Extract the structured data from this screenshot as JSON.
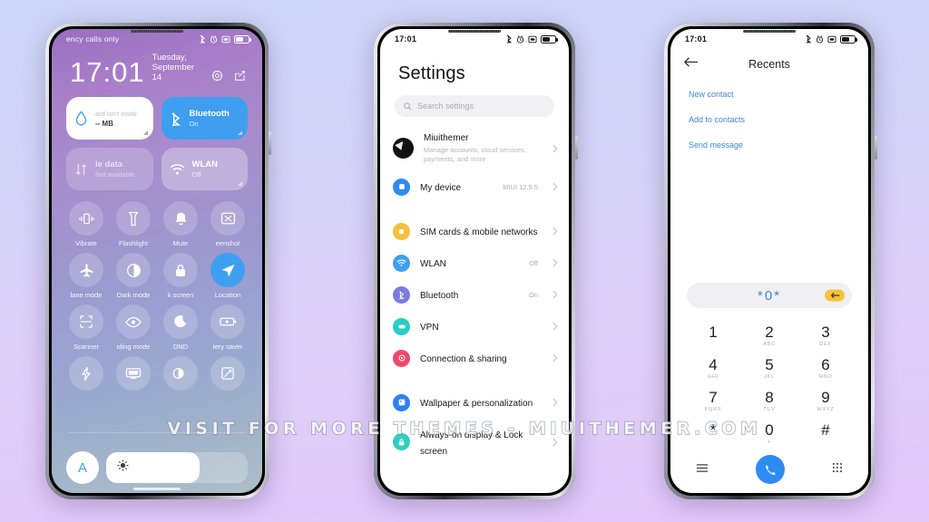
{
  "background": {
    "top_color": "#cdd6f7",
    "bottom_color": "#e3c8f8"
  },
  "watermark": {
    "text": "VISIT FOR MORE THEMES - MIUITHEMER.COM"
  },
  "accent": {
    "blue": "#3e9ff0",
    "link_blue": "#3d86d8",
    "call_green_blue": "#2d8cf5",
    "yellow": "#f5c43c"
  },
  "phone1": {
    "statusbar": {
      "carrier": "ency calls only",
      "icons": [
        "bluetooth-icon",
        "alarm-icon",
        "sim-icon",
        "battery-icon"
      ]
    },
    "clock": {
      "time": "17:01",
      "date": "Tuesday, September 14"
    },
    "header_actions": [
      "settings-gear-icon",
      "edit-icon"
    ],
    "big_tiles": [
      {
        "name": "data-usage",
        "icon": "water-drop-icon",
        "warning": "ard isn't instal",
        "usage": "-- MB",
        "state": "white"
      },
      {
        "name": "bluetooth",
        "icon": "bluetooth-icon",
        "title": "Bluetooth",
        "sub": "On",
        "state": "blue"
      },
      {
        "name": "mobile-data",
        "icon": "data-arrows-icon",
        "title": "le data",
        "sub": "Not available",
        "state": "dim"
      },
      {
        "name": "wlan",
        "icon": "wifi-icon",
        "title": "WLAN",
        "sub": "Off",
        "state": "translucent"
      }
    ],
    "toggles": [
      {
        "label": "Vibrate",
        "icon": "vibrate-icon",
        "on": false
      },
      {
        "label": "Flashlight",
        "icon": "flashlight-icon",
        "on": false
      },
      {
        "label": "Mute",
        "icon": "bell-icon",
        "on": false
      },
      {
        "label": "eenshot",
        "icon": "screenshot-icon",
        "on": false
      },
      {
        "label": "lane mode",
        "icon": "airplane-icon",
        "on": false
      },
      {
        "label": "Dark mode",
        "icon": "contrast-icon",
        "on": false
      },
      {
        "label": "k screen",
        "icon": "lock-icon",
        "on": false
      },
      {
        "label": "Location",
        "icon": "location-arrow-icon",
        "on": true
      },
      {
        "label": "Scanner",
        "icon": "scan-frame-icon",
        "on": false
      },
      {
        "label": "iding mode",
        "icon": "eye-icon",
        "on": false
      },
      {
        "label": "DND",
        "icon": "moon-icon",
        "on": false
      },
      {
        "label": "tery saver",
        "icon": "battery-plus-icon",
        "on": false
      },
      {
        "label": "",
        "icon": "lightning-icon",
        "on": false
      },
      {
        "label": "",
        "icon": "cast-icon",
        "on": false
      },
      {
        "label": "",
        "icon": "half-circle-icon",
        "on": false
      },
      {
        "label": "",
        "icon": "rotate-icon",
        "on": false
      }
    ],
    "brightness": {
      "auto_label": "A",
      "icon": "sun-icon",
      "level_percent": 66
    }
  },
  "phone2": {
    "statusbar": {
      "time": "17:01",
      "icons": [
        "bluetooth-icon",
        "alarm-icon",
        "sim-icon",
        "battery-icon"
      ]
    },
    "title": "Settings",
    "search": {
      "placeholder": "Search settings",
      "icon": "search-icon"
    },
    "groups": [
      {
        "rows": [
          {
            "label": "Miuithemer",
            "sub": "Manage accounts, cloud services, payments, and more",
            "value": "",
            "icon": "avatar",
            "icon_color": "#111111"
          },
          {
            "label": "My device",
            "sub": "",
            "value": "MIUI 12.5.5",
            "icon": "device-icon",
            "icon_color": "#2d8cf5"
          }
        ]
      },
      {
        "rows": [
          {
            "label": "SIM cards & mobile networks",
            "sub": "",
            "value": "",
            "icon": "sim-card-icon",
            "icon_color": "#f6bf3c"
          },
          {
            "label": "WLAN",
            "sub": "",
            "value": "Off",
            "icon": "wifi-icon",
            "icon_color": "#3e9ff0"
          },
          {
            "label": "Bluetooth",
            "sub": "",
            "value": "On",
            "icon": "bluetooth-icon",
            "icon_color": "#7b7ce0"
          },
          {
            "label": "VPN",
            "sub": "",
            "value": "",
            "icon": "vpn-icon",
            "icon_color": "#27cdc6"
          },
          {
            "label": "Connection & sharing",
            "sub": "",
            "value": "",
            "icon": "share-nodes-icon",
            "icon_color": "#f2476b"
          }
        ]
      },
      {
        "rows": [
          {
            "label": "Wallpaper & personalization",
            "sub": "",
            "value": "",
            "icon": "wallpaper-icon",
            "icon_color": "#2d7ff5"
          },
          {
            "label": "Always-on display & Lock screen",
            "sub": "",
            "value": "",
            "icon": "lock-icon",
            "icon_color": "#2ecfc2"
          }
        ]
      }
    ]
  },
  "phone3": {
    "statusbar": {
      "time": "17:01",
      "icons": [
        "bluetooth-icon",
        "alarm-icon",
        "sim-icon",
        "battery-icon"
      ]
    },
    "header": {
      "back_icon": "arrow-left-icon",
      "title": "Recents"
    },
    "links": [
      "New contact",
      "Add to contacts",
      "Send message"
    ],
    "number_field": {
      "value": "*0*",
      "backspace_icon": "backspace-icon"
    },
    "keypad": [
      {
        "digit": "1",
        "letters": ""
      },
      {
        "digit": "2",
        "letters": "ABC"
      },
      {
        "digit": "3",
        "letters": "DEF"
      },
      {
        "digit": "4",
        "letters": "GHI"
      },
      {
        "digit": "5",
        "letters": "JKL"
      },
      {
        "digit": "6",
        "letters": "MNO"
      },
      {
        "digit": "7",
        "letters": "PQRS"
      },
      {
        "digit": "8",
        "letters": "TUV"
      },
      {
        "digit": "9",
        "letters": "WXYZ"
      },
      {
        "digit": "*",
        "letters": ""
      },
      {
        "digit": "0",
        "letters": "+"
      },
      {
        "digit": "#",
        "letters": ""
      }
    ],
    "nav": {
      "left_icon": "menu-icon",
      "call_icon": "phone-icon",
      "right_icon": "dialpad-icon"
    }
  }
}
